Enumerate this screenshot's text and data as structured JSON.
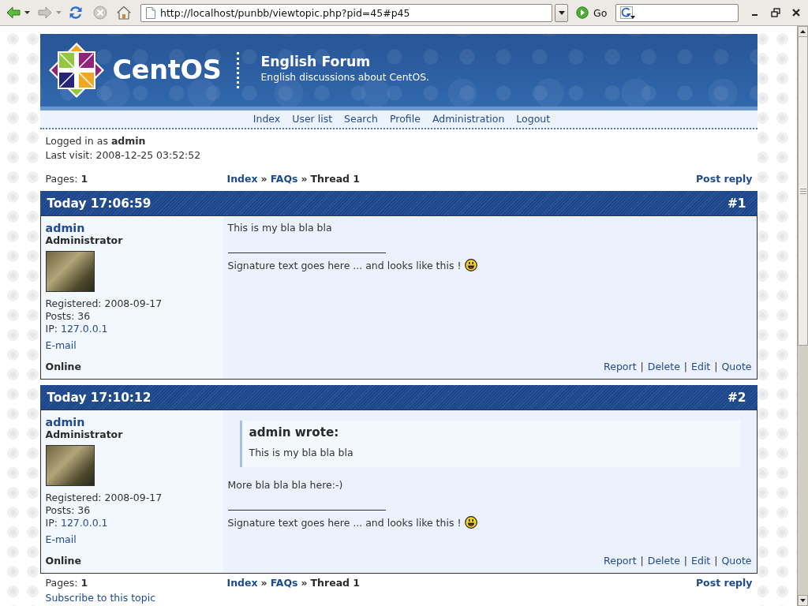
{
  "browser": {
    "url": "http://localhost/punbb/viewtopic.php?pid=45#p45",
    "go": "Go"
  },
  "header": {
    "logo_text": "CentOS",
    "title": "English Forum",
    "description": "English discussions about CentOS."
  },
  "nav": [
    "Index",
    "User list",
    "Search",
    "Profile",
    "Administration",
    "Logout"
  ],
  "status": {
    "logged_in": "Logged in as **admin**",
    "last_visit": "Last visit: 2008-12-25 03:52:52"
  },
  "top_links": {
    "pages": "Pages: **1**",
    "breadcrumbs": [
      {
        "kind": "link",
        "label": "Index"
      },
      {
        "kind": "separator",
        "label": "»"
      },
      {
        "kind": "link",
        "label": "FAQs"
      },
      {
        "kind": "separator",
        "label": "»"
      },
      {
        "kind": "current",
        "label": "Thread 1"
      }
    ],
    "post_reply": "Post reply"
  },
  "posts": [
    {
      "time": "Today 17:06:59",
      "number": "#1",
      "author": "admin",
      "role": "Administrator",
      "registered": "Registered: 2008-09-17",
      "post_count": "Posts: 36",
      "ip_label": "IP:",
      "ip": "127.0.0.1",
      "email": "E-mail",
      "status": "Online",
      "message": "This is my bla bla bla",
      "signature": "Signature text goes here ... and looks like this !",
      "actions": [
        {
          "kind": "link",
          "label": "Report"
        },
        {
          "kind": "separator",
          "label": "|"
        },
        {
          "kind": "link",
          "label": "Delete"
        },
        {
          "kind": "separator",
          "label": "|"
        },
        {
          "kind": "link",
          "label": "Edit"
        },
        {
          "kind": "separator",
          "label": "|"
        },
        {
          "kind": "link",
          "label": "Quote"
        }
      ]
    },
    {
      "time": "Today 17:10:12",
      "number": "#2",
      "author": "admin",
      "role": "Administrator",
      "registered": "Registered: 2008-09-17",
      "post_count": "Posts: 36",
      "ip_label": "IP:",
      "ip": "127.0.0.1",
      "email": "E-mail",
      "status": "Online",
      "quote": {
        "title": "admin wrote:",
        "text": "This is my bla bla bla"
      },
      "message": "More bla bla bla here:-)",
      "signature": "Signature text goes here ... and looks like this !",
      "actions": [
        {
          "kind": "link",
          "label": "Report"
        },
        {
          "kind": "separator",
          "label": "|"
        },
        {
          "kind": "link",
          "label": "Delete"
        },
        {
          "kind": "separator",
          "label": "|"
        },
        {
          "kind": "link",
          "label": "Edit"
        },
        {
          "kind": "separator",
          "label": "|"
        },
        {
          "kind": "link",
          "label": "Quote"
        }
      ]
    }
  ],
  "bottom_links": {
    "pages": "Pages: **1**",
    "breadcrumbs": [
      {
        "kind": "link",
        "label": "Index"
      },
      {
        "kind": "separator",
        "label": "»"
      },
      {
        "kind": "link",
        "label": "FAQs"
      },
      {
        "kind": "separator",
        "label": "»"
      },
      {
        "kind": "current",
        "label": "Thread 1"
      }
    ],
    "post_reply": "Post reply"
  },
  "subscribe": "Subscribe to this topic"
}
